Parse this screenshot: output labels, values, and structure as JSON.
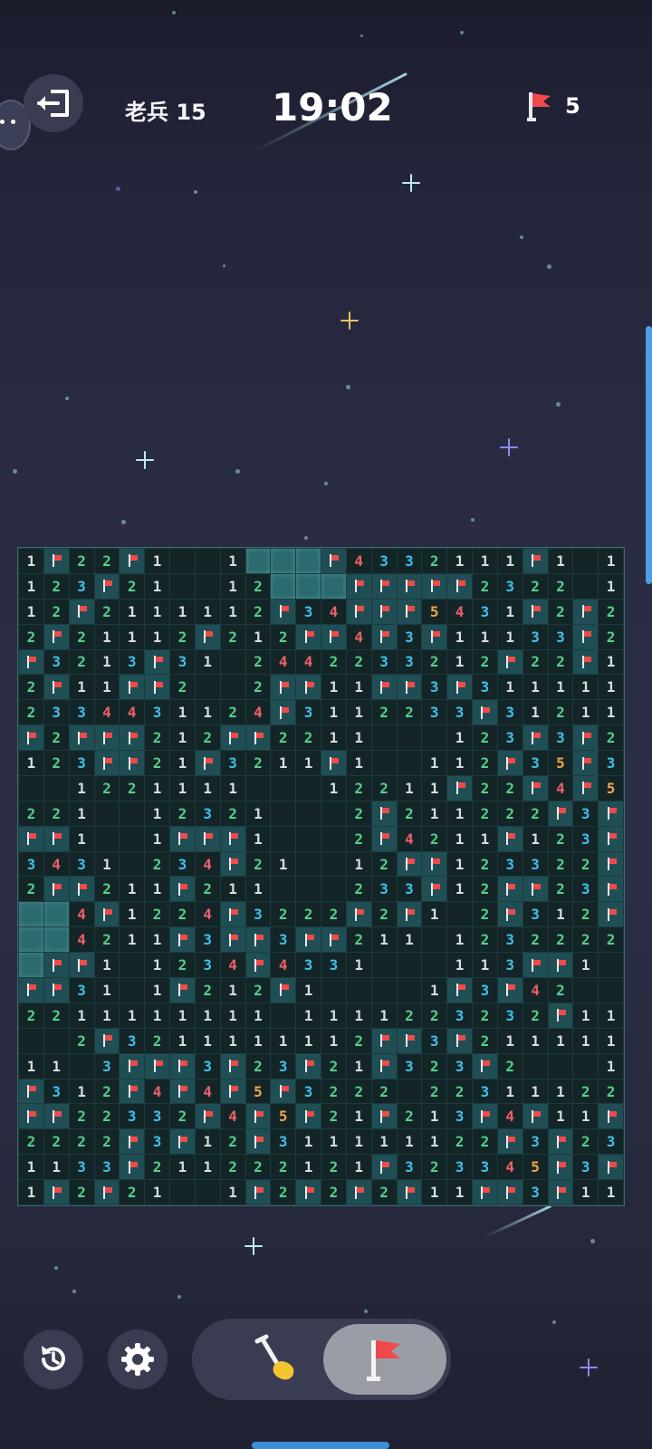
{
  "header": {
    "level_label": "老兵 15",
    "timer": "19:02",
    "flags_remaining": "5"
  },
  "icons": {
    "exit": "exit-icon",
    "flag": "flag-icon",
    "restart": "restart-icon",
    "settings": "gear-icon",
    "dig": "shovel-icon"
  },
  "colors": {
    "n1": "#d7dde2",
    "n2": "#55d08a",
    "n3": "#3fc0e8",
    "n4": "#f0606a",
    "n5": "#f0a64a",
    "flag": "#ef4a4a",
    "accent": "#4a9fe3"
  },
  "board": {
    "cols": 24,
    "legend": "digit = revealed number, F = flagged, H = hidden (unrevealed), . = revealed empty",
    "rows": [
      "1F22F1..1HHHF4332111F1.1F",
      "123F21..12HHHFFFFF2322.11",
      "12F2111112F34FFF5431F2F21.",
      "2F21112F212FF4F3F11133F211",
      "F3213F31.2442233212F22F1",
      "2F11FF2..2FF11FF3F311111",
      "2334431124F3112233F31211",
      "F2FFF212FF2211...123F3F2.",
      "123FF21F3211F1..112F35F3",
      "..1221111...12211F22F4F52",
      "221..12321...2F211222F3FF",
      "FF1..1FFF1...2F4211F123F42",
      "3431.234F21..12FF123322F21",
      "2FF211F211...233F12FF23F3",
      "HH4F1224F3222F2F1.2F312FF",
      "HH4211F3FF3FF211.1232222",
      "HFF1.1234F4331...113FF1..",
      "FF31.1F212F1....1F3F42..",
      "2211111111.1111223232F111",
      "..2F3211111112FF3F211111F",
      "11.3FFF3F23F21F323F2...11",
      "F312F4F4F5F3222.22311122",
      "FF22332F4F5F21F213F4F11FF",
      "2222F3F12F311111122F3F2333",
      "1133F211222121F323345F3F1",
      "1F2F21..1F2F2F2F11FF3F11"
    ]
  },
  "controls": {
    "mode_selected": "flag"
  }
}
